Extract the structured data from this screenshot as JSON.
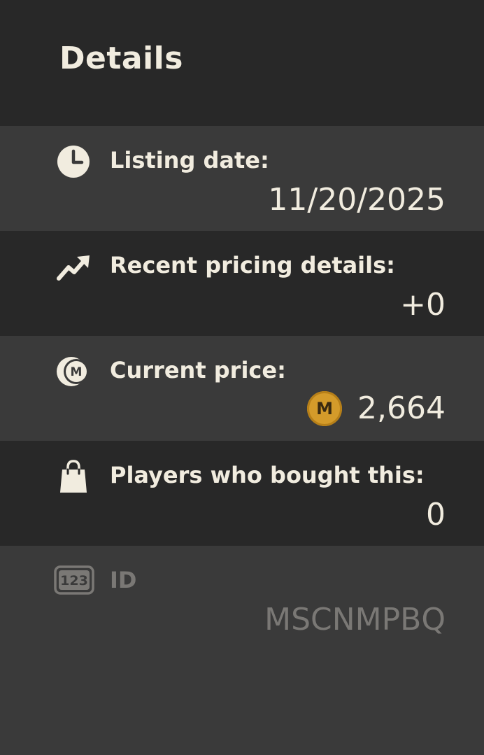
{
  "header": {
    "title": "Details"
  },
  "details": {
    "listing_date": {
      "label": "Listing date:",
      "value": "11/20/2025",
      "icon": "clock-icon"
    },
    "recent_pricing": {
      "label": "Recent pricing details:",
      "value": "+0",
      "icon": "trending-up-icon"
    },
    "current_price": {
      "label": "Current price:",
      "value": "2,664",
      "icon": "currency-icon",
      "coin_letter": "M"
    },
    "players_bought": {
      "label": "Players who bought this:",
      "value": "0",
      "icon": "shopping-bag-icon"
    },
    "id": {
      "label": "ID",
      "value": "MSCNMPBQ",
      "icon": "numbers-123-icon",
      "icon_text": "123"
    }
  },
  "colors": {
    "background_dark": "#282828",
    "background_light": "#3a3a3a",
    "text_primary": "#f1ecdf",
    "text_muted": "#7a7875",
    "coin": "#d49b2a"
  }
}
